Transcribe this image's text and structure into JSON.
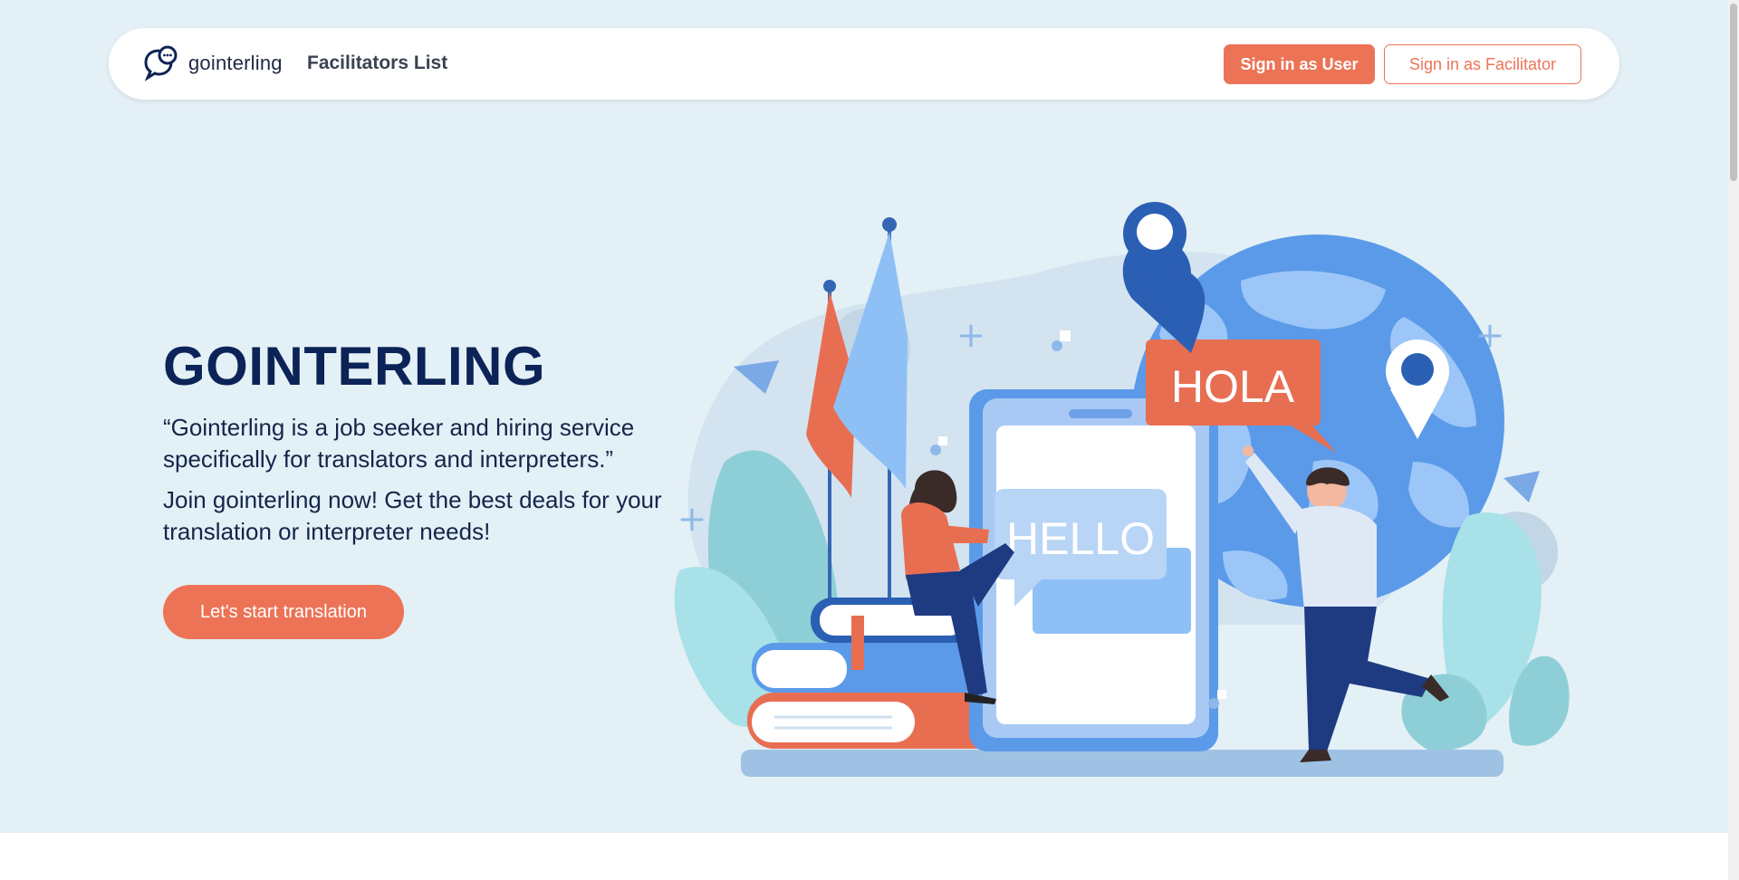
{
  "nav": {
    "brand_name": "gointerling",
    "link_facilitators": "Facilitators List",
    "btn_user": "Sign in as User",
    "btn_facilitator": "Sign in as Facilitator"
  },
  "hero": {
    "title": "GOINTERLING",
    "quote": "“Gointerling is a job seeker and hiring service specifically for translators and interpreters.”",
    "subtitle": "Join gointerling now! Get the best deals for your translation or interpreter needs!",
    "cta": "Let's start translation"
  },
  "illustration": {
    "bubble_hola": "HOLA",
    "bubble_hello": "HELLO"
  },
  "colors": {
    "accent": "#ec7356",
    "hero_bg": "#e3f0f6",
    "title": "#0c2357"
  }
}
